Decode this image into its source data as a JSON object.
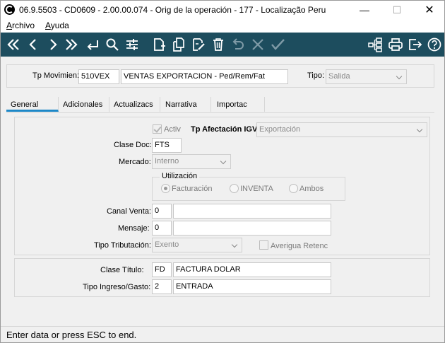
{
  "window": {
    "title": "06.9.5503 - CD0609 - 2.00.00.074 - Orig de la operación - 177 - Localização Peru",
    "min_glyph": "—",
    "max_glyph": "☐",
    "close_glyph": "✕"
  },
  "menu": {
    "archivo_first": "A",
    "archivo_rest": "rchivo",
    "ayuda_first": "A",
    "ayuda_rest": "yuda"
  },
  "toolbar": {
    "icons": [
      "first-icon",
      "previous-icon",
      "next-icon",
      "last-icon",
      "return-icon",
      "search-icon",
      "filter-icon",
      "new-icon",
      "copy-icon",
      "edit-icon",
      "delete-icon",
      "undo-icon",
      "cancel-icon",
      "confirm-icon",
      "tree-icon",
      "print-icon",
      "exit-icon",
      "help-icon"
    ],
    "color": "#1d4d5e"
  },
  "header": {
    "tp_movimien_label": "Tp Movimien:",
    "tp_movimien_code": "510VEX",
    "tp_movimien_desc": "VENTAS EXPORTACION - Ped/Rem/Fat",
    "tipo_label": "Tipo:",
    "tipo_value": "Salida"
  },
  "tabs": [
    {
      "label": "General",
      "active": true
    },
    {
      "label": "Adicionales"
    },
    {
      "label": "Actualizacs"
    },
    {
      "label": "Narrativa"
    },
    {
      "label": "Importac"
    }
  ],
  "general": {
    "activ_label": "Activ",
    "activ_checked": true,
    "tp_afectacion_label": "Tp Afectación IGV:",
    "tp_afectacion_value": "Exportación",
    "clase_doc_label": "Clase Doc:",
    "clase_doc_value": "FTS",
    "mercado_label": "Mercado:",
    "mercado_value": "Interno",
    "utilizacion_label": "Utilización",
    "utilizacion_options": [
      "Facturación",
      "INVENTA",
      "Ambos"
    ],
    "utilizacion_selected": "Facturación",
    "canal_venta_label": "Canal Venta:",
    "canal_venta_code": "0",
    "canal_venta_desc": "",
    "mensaje_label": "Mensaje:",
    "mensaje_code": "0",
    "mensaje_desc": "",
    "tipo_tributacion_label": "Tipo Tributación:",
    "tipo_tributacion_value": "Exento",
    "averigua_label": "Averigua Retenc",
    "averigua_checked": false,
    "clase_titulo_label": "Clase Título:",
    "clase_titulo_code": "FD",
    "clase_titulo_desc": "FACTURA DOLAR",
    "tipo_ingreso_label": "Tipo Ingreso/Gasto:",
    "tipo_ingreso_code": "2",
    "tipo_ingreso_desc": "ENTRADA"
  },
  "status": {
    "message": "Enter data or press ESC to end."
  },
  "colors": {
    "tab_active_underline": "#1e88c7"
  }
}
